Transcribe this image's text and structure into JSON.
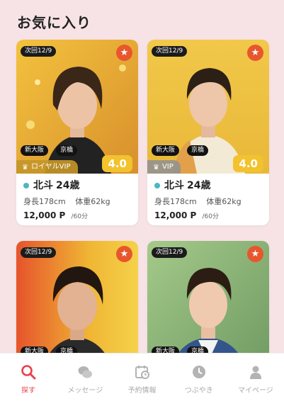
{
  "page": {
    "title": "お気に入り"
  },
  "cards": [
    {
      "next_label": "次回12/9",
      "areas": [
        "新大阪",
        "京橋"
      ],
      "rank": "ロイヤルVIP",
      "rating": "4.0",
      "name": "北斗",
      "age": "24歳",
      "height": "身長178cm",
      "weight": "体重62kg",
      "price": "12,000 P",
      "per": "/60分"
    },
    {
      "next_label": "次回12/9",
      "areas": [
        "新大阪",
        "京橋"
      ],
      "rank": "VIP",
      "rating": "4.0",
      "name": "北斗",
      "age": "24歳",
      "height": "身長178cm",
      "weight": "体重62kg",
      "price": "12,000 P",
      "per": "/60分"
    },
    {
      "next_label": "次回12/9",
      "areas": [
        "新大阪",
        "京橋"
      ]
    },
    {
      "next_label": "次回12/9",
      "areas": [
        "新大阪",
        "京橋"
      ]
    }
  ],
  "nav": [
    {
      "label": "探す",
      "icon": "search-icon",
      "active": true
    },
    {
      "label": "メッセージ",
      "icon": "chat-icon",
      "active": false
    },
    {
      "label": "予約情報",
      "icon": "calendar-clock-icon",
      "active": false
    },
    {
      "label": "つぶやき",
      "icon": "clock-icon",
      "active": false
    },
    {
      "label": "マイページ",
      "icon": "user-icon",
      "active": false
    }
  ],
  "colors": {
    "background": "#f7e3e6",
    "accent": "#e8424b",
    "favorite": "#e8562d",
    "rating": "#f2c22f",
    "online": "#4cb7c3"
  }
}
